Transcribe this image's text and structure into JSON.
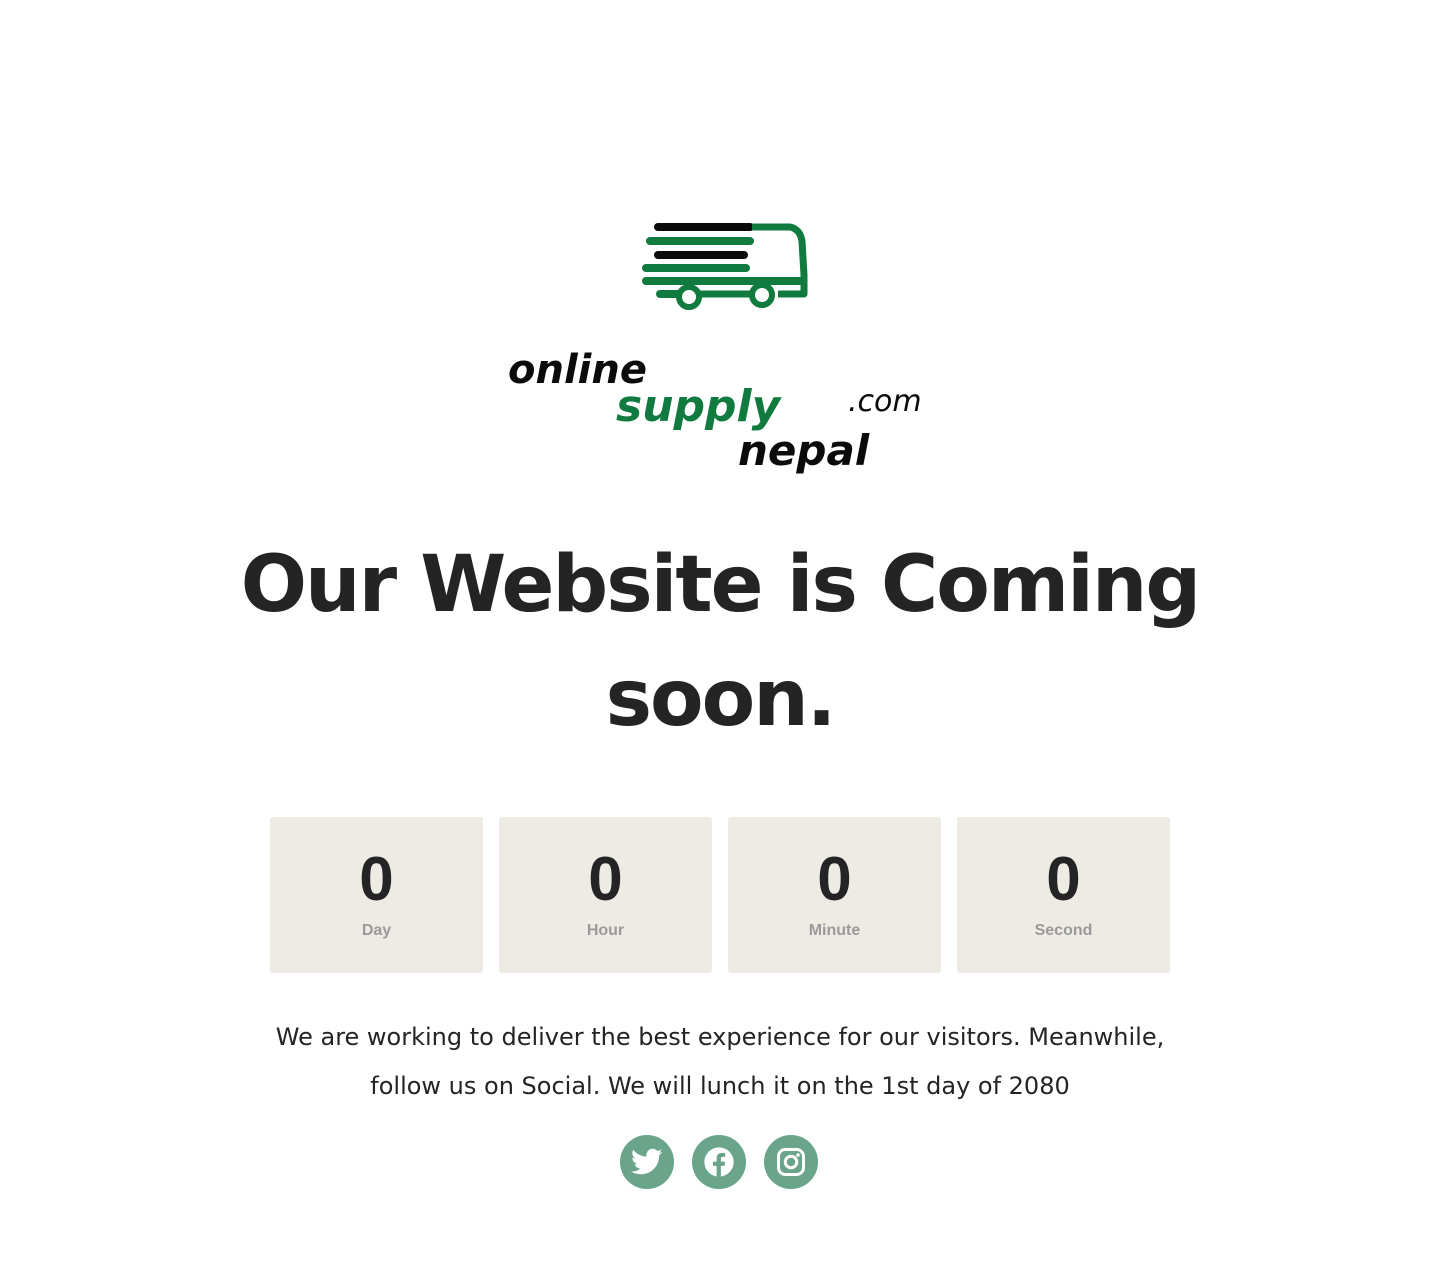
{
  "logo": {
    "word_online": "online",
    "word_supply": "supply",
    "word_com": ".com",
    "word_nepal": "nepal",
    "colors": {
      "green": "#107a3f",
      "black": "#0b0b0b"
    }
  },
  "heading": {
    "line1": "Our Website is Coming",
    "line2": "soon."
  },
  "countdown": [
    {
      "value": "0",
      "label": "Day"
    },
    {
      "value": "0",
      "label": "Hour"
    },
    {
      "value": "0",
      "label": "Minute"
    },
    {
      "value": "0",
      "label": "Second"
    }
  ],
  "message": {
    "line1": "We are working to deliver the best experience for our visitors. Meanwhile,",
    "line2": "follow us on Social. We will lunch it on the 1st day of 2080"
  },
  "social": [
    {
      "name": "Twitter",
      "icon": "twitter-icon"
    },
    {
      "name": "Facebook",
      "icon": "facebook-icon"
    },
    {
      "name": "Instagram",
      "icon": "instagram-icon"
    }
  ],
  "colors": {
    "background": "#ffffff",
    "text": "#242424",
    "countdown_box": "#eeebe5",
    "countdown_label": "#9a9a9a",
    "social_bg": "#69a48b"
  }
}
